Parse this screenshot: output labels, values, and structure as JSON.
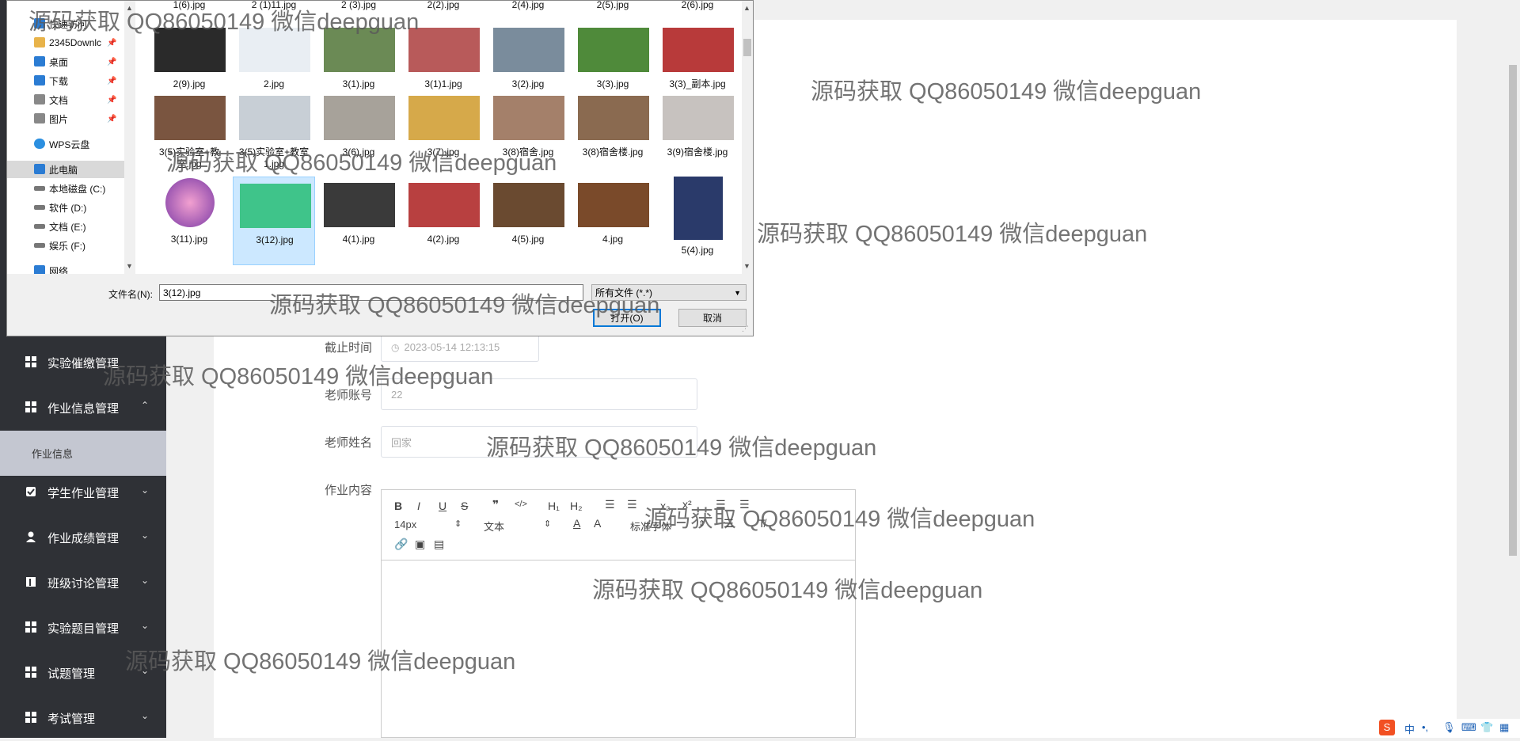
{
  "sidebar": {
    "items": [
      {
        "label": "实验催缴管理",
        "icon": "grid-icon",
        "chevron": ""
      },
      {
        "label": "作业信息管理",
        "icon": "grid-icon",
        "chevron": "^"
      },
      {
        "label": "作业信息",
        "sub": true
      },
      {
        "label": "学生作业管理",
        "icon": "check-icon",
        "chevron": "v"
      },
      {
        "label": "作业成绩管理",
        "icon": "user-icon",
        "chevron": "v"
      },
      {
        "label": "班级讨论管理",
        "icon": "book-icon",
        "chevron": "v"
      },
      {
        "label": "实验题目管理",
        "icon": "grid-icon",
        "chevron": "v"
      },
      {
        "label": "试题管理",
        "icon": "grid-icon",
        "chevron": "v"
      },
      {
        "label": "考试管理",
        "icon": "grid-icon",
        "chevron": "v"
      }
    ]
  },
  "form": {
    "deadline_label": "截止时间",
    "deadline_value": "2023-05-14 12:13:15",
    "teacher_account_label": "老师账号",
    "teacher_account_value": "22",
    "teacher_name_label": "老师姓名",
    "teacher_name_value": "回家",
    "content_label": "作业内容"
  },
  "editor": {
    "font_size": "14px",
    "text_style": "文本",
    "font_family": "标准字体"
  },
  "dialog": {
    "nav": [
      {
        "label": "快速访问",
        "icon": "star-icon"
      },
      {
        "label": "2345Downlc",
        "icon": "folder-icon",
        "pinned": true
      },
      {
        "label": "桌面",
        "icon": "desktop-icon",
        "pinned": true
      },
      {
        "label": "下载",
        "icon": "download-icon",
        "pinned": true
      },
      {
        "label": "文档",
        "icon": "document-icon",
        "pinned": true
      },
      {
        "label": "图片",
        "icon": "picture-icon",
        "pinned": true
      },
      {
        "label": "WPS云盘",
        "icon": "cloud-icon"
      },
      {
        "label": "此电脑",
        "icon": "computer-icon",
        "selected": true
      },
      {
        "label": "本地磁盘 (C:)",
        "icon": "drive-icon"
      },
      {
        "label": "软件 (D:)",
        "icon": "drive-icon"
      },
      {
        "label": "文档 (E:)",
        "icon": "drive-icon"
      },
      {
        "label": "娱乐 (F:)",
        "icon": "drive-icon"
      },
      {
        "label": "网络",
        "icon": "network-icon"
      }
    ],
    "top_row": [
      "1(6).jpg",
      "2 (1)11.jpg",
      "2 (3).jpg",
      "2(2).jpg",
      "2(4).jpg",
      "2(5).jpg",
      "2(6).jpg"
    ],
    "row1": [
      "2(9).jpg",
      "2.jpg",
      "3(1).jpg",
      "3(1)1.jpg",
      "3(2).jpg",
      "3(3).jpg",
      "3(3)_副本.jpg"
    ],
    "row2": [
      "3(5)实验室+教室.jpg",
      "3(5)实验室+教室1.jpg",
      "3(6).jpg",
      "3(7).jpg",
      "3(8)宿舍.jpg",
      "3(8)宿舍楼.jpg",
      "3(9)宿舍楼.jpg"
    ],
    "row3": [
      "3(11).jpg",
      "3(12).jpg",
      "4(1).jpg",
      "4(2).jpg",
      "4(5).jpg",
      "4.jpg",
      "5(4).jpg"
    ],
    "filename_label": "文件名(N):",
    "filename_value": "3(12).jpg",
    "filetype_value": "所有文件 (*.*)",
    "open_label": "打开(O)",
    "cancel_label": "取消"
  },
  "watermark": "源码获取 QQ86050149 微信deepguan",
  "colors": {
    "sidebar_bg": "#2f3136",
    "selected_file": "#cce8ff",
    "accent": "#0078d7"
  }
}
